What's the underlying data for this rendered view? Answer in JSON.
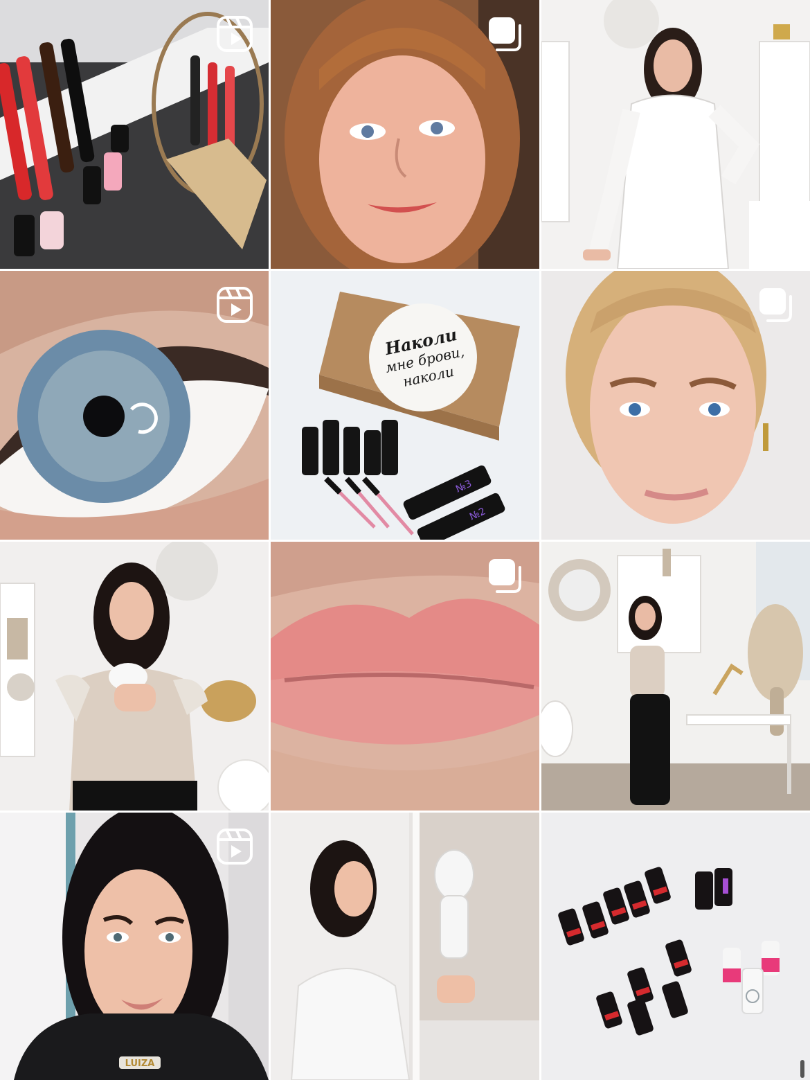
{
  "grid": {
    "posts": [
      {
        "type": "reel",
        "badge_icon": "reels-icon"
      },
      {
        "type": "carousel",
        "badge_icon": "carousel-icon"
      },
      {
        "type": "photo",
        "badge_icon": ""
      },
      {
        "type": "reel",
        "badge_icon": "reels-icon"
      },
      {
        "type": "photo",
        "badge_icon": "",
        "box_text_line1": "Наколи",
        "box_text_line2": "мне брови,",
        "box_text_line3": "наколи",
        "tube_label_1": "№3",
        "tube_label_2": "№2"
      },
      {
        "type": "carousel",
        "badge_icon": "carousel-icon"
      },
      {
        "type": "photo",
        "badge_icon": ""
      },
      {
        "type": "carousel",
        "badge_icon": "carousel-icon"
      },
      {
        "type": "photo",
        "badge_icon": ""
      },
      {
        "type": "reel",
        "badge_icon": "reels-icon",
        "necklace_text": "LUIZA"
      },
      {
        "type": "photo",
        "badge_icon": ""
      },
      {
        "type": "photo",
        "badge_icon": ""
      }
    ]
  },
  "colors": {
    "badge": "#ffffff",
    "background": "#ffffff",
    "scrollbar": "#3a3a3a"
  }
}
